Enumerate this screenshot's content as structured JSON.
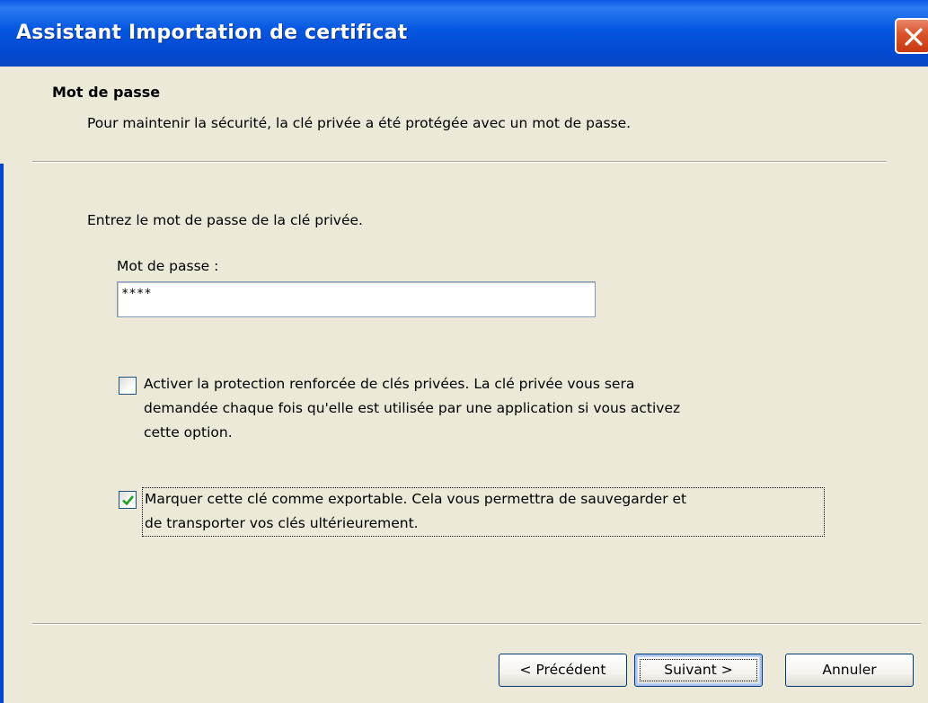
{
  "window": {
    "title": "Assistant Importation de certificat",
    "close_icon": "close-icon",
    "accent": "#0556e0",
    "close_color": "#d9542a"
  },
  "header": {
    "title": "Mot de passe",
    "subtitle": "Pour maintenir la sécurité, la clé privée a été protégée avec un mot de passe."
  },
  "body": {
    "prompt": "Entrez le mot de passe de la clé privée.",
    "password": {
      "label": "Mot de passe :",
      "value": "****"
    },
    "options": [
      {
        "checked": false,
        "line1": "Activer la protection renforcée de clés privées. La clé privée vous sera",
        "line2": "demandée chaque fois qu'elle est utilisée par une application si vous activez",
        "line3": "cette option."
      },
      {
        "checked": true,
        "line1": "Marquer cette clé comme exportable. Cela vous permettra de sauvegarder et",
        "line2": "de transporter vos clés ultérieurement."
      }
    ]
  },
  "buttons": {
    "back": "< Précédent",
    "next": "Suivant >",
    "cancel": "Annuler"
  }
}
